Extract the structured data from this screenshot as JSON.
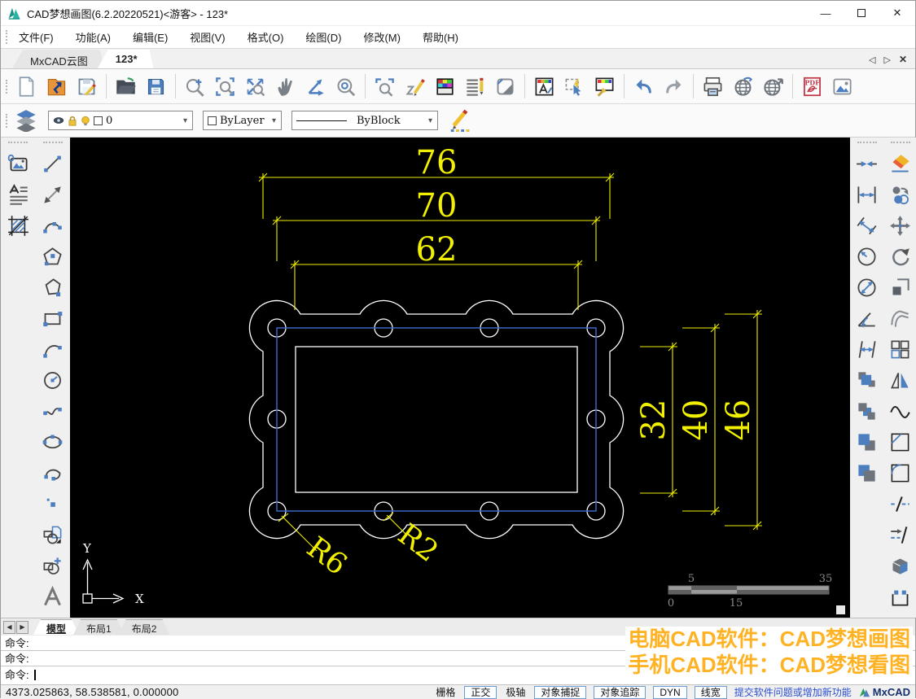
{
  "window": {
    "title": "CAD梦想画图(6.2.20220521)<游客> - 123*",
    "controls": {
      "minimize": "minimize",
      "maximize": "maximize",
      "close": "close"
    }
  },
  "menu": {
    "items": [
      "文件(F)",
      "功能(A)",
      "编辑(E)",
      "视图(V)",
      "格式(O)",
      "绘图(D)",
      "修改(M)",
      "帮助(H)"
    ]
  },
  "doc_tabs": {
    "items": [
      "MxCAD云图",
      "123*"
    ],
    "active": "123*"
  },
  "toolbar": {
    "icons": [
      "new-file",
      "open-drawing",
      "save",
      "open-folder",
      "save-as",
      "zoom-in",
      "zoom-window",
      "zoom-extents",
      "pan",
      "ucs-axes",
      "zoom-circle",
      "zoom-previous",
      "sketch",
      "color-palette",
      "mtext-edit",
      "clip-image",
      "text-style",
      "quick-select",
      "match-properties",
      "undo",
      "redo",
      "print",
      "web-publish",
      "web-upload",
      "export-pdf",
      "export-image"
    ],
    "pdf_label": "PDF"
  },
  "properties_bar": {
    "layer": "0",
    "color": "ByLayer",
    "linetype": "ByBlock"
  },
  "left_toolbar": {
    "icons_a": [
      "insert-image",
      "mtext",
      "hatch"
    ],
    "icons_b": [
      "line",
      "construction-line",
      "polyline",
      "polygon",
      "polygon-inscribed",
      "rectangle",
      "arc",
      "circle",
      "spline",
      "ellipse",
      "arc-continue",
      "point",
      "insert-block",
      "create-block",
      "text"
    ]
  },
  "right_toolbar": {
    "icons_a": [
      "dim-quick",
      "dim-linear",
      "dim-aligned",
      "dim-radius",
      "dim-diameter",
      "dim-angular",
      "dim-baseline",
      "draworder-front",
      "draworder-back",
      "draworder-above",
      "draworder-below"
    ],
    "icons_b": [
      "erase",
      "copy",
      "move",
      "rotate",
      "scale",
      "offset",
      "array",
      "mirror",
      "edit-spline",
      "chamfer",
      "fillet",
      "break",
      "lengthen",
      "explode",
      "stretch"
    ]
  },
  "drawing": {
    "dims_horizontal": [
      "76",
      "70",
      "62"
    ],
    "dims_vertical": [
      "32",
      "40",
      "46"
    ],
    "radius_labels": [
      "R6",
      "R2"
    ],
    "axis_labels": {
      "x": "X",
      "y": "Y"
    },
    "scale_bar": {
      "top_left": "5",
      "top_right": "35",
      "bottom_left": "0",
      "bottom_mid": "15"
    },
    "colors": {
      "dimension": "#f0f000",
      "geometry": "#ffffff",
      "frame": "#3a66c4",
      "background": "#000000"
    }
  },
  "layout_tabs": {
    "items": [
      "模型",
      "布局1",
      "布局2"
    ],
    "active": "模型"
  },
  "command": {
    "prompt1": "命令:",
    "prompt2": "命令:",
    "prompt3": "命令:"
  },
  "watermark": {
    "line1": "电脑CAD软件：CAD梦想画图",
    "line2": "手机CAD软件：CAD梦想看图",
    "color": "#ffb324"
  },
  "status_bar": {
    "coordinates": "4373.025863,  58.538581,  0.000000",
    "toggles": [
      {
        "label": "栅格",
        "active": false
      },
      {
        "label": "正交",
        "active": true
      },
      {
        "label": "极轴",
        "active": false
      },
      {
        "label": "对象捕捉",
        "active": true
      },
      {
        "label": "对象追踪",
        "active": true
      },
      {
        "label": "DYN",
        "active": true
      },
      {
        "label": "线宽",
        "active": true
      }
    ],
    "feedback_link": "提交软件问题或增加新功能",
    "brand": "MxCAD"
  }
}
